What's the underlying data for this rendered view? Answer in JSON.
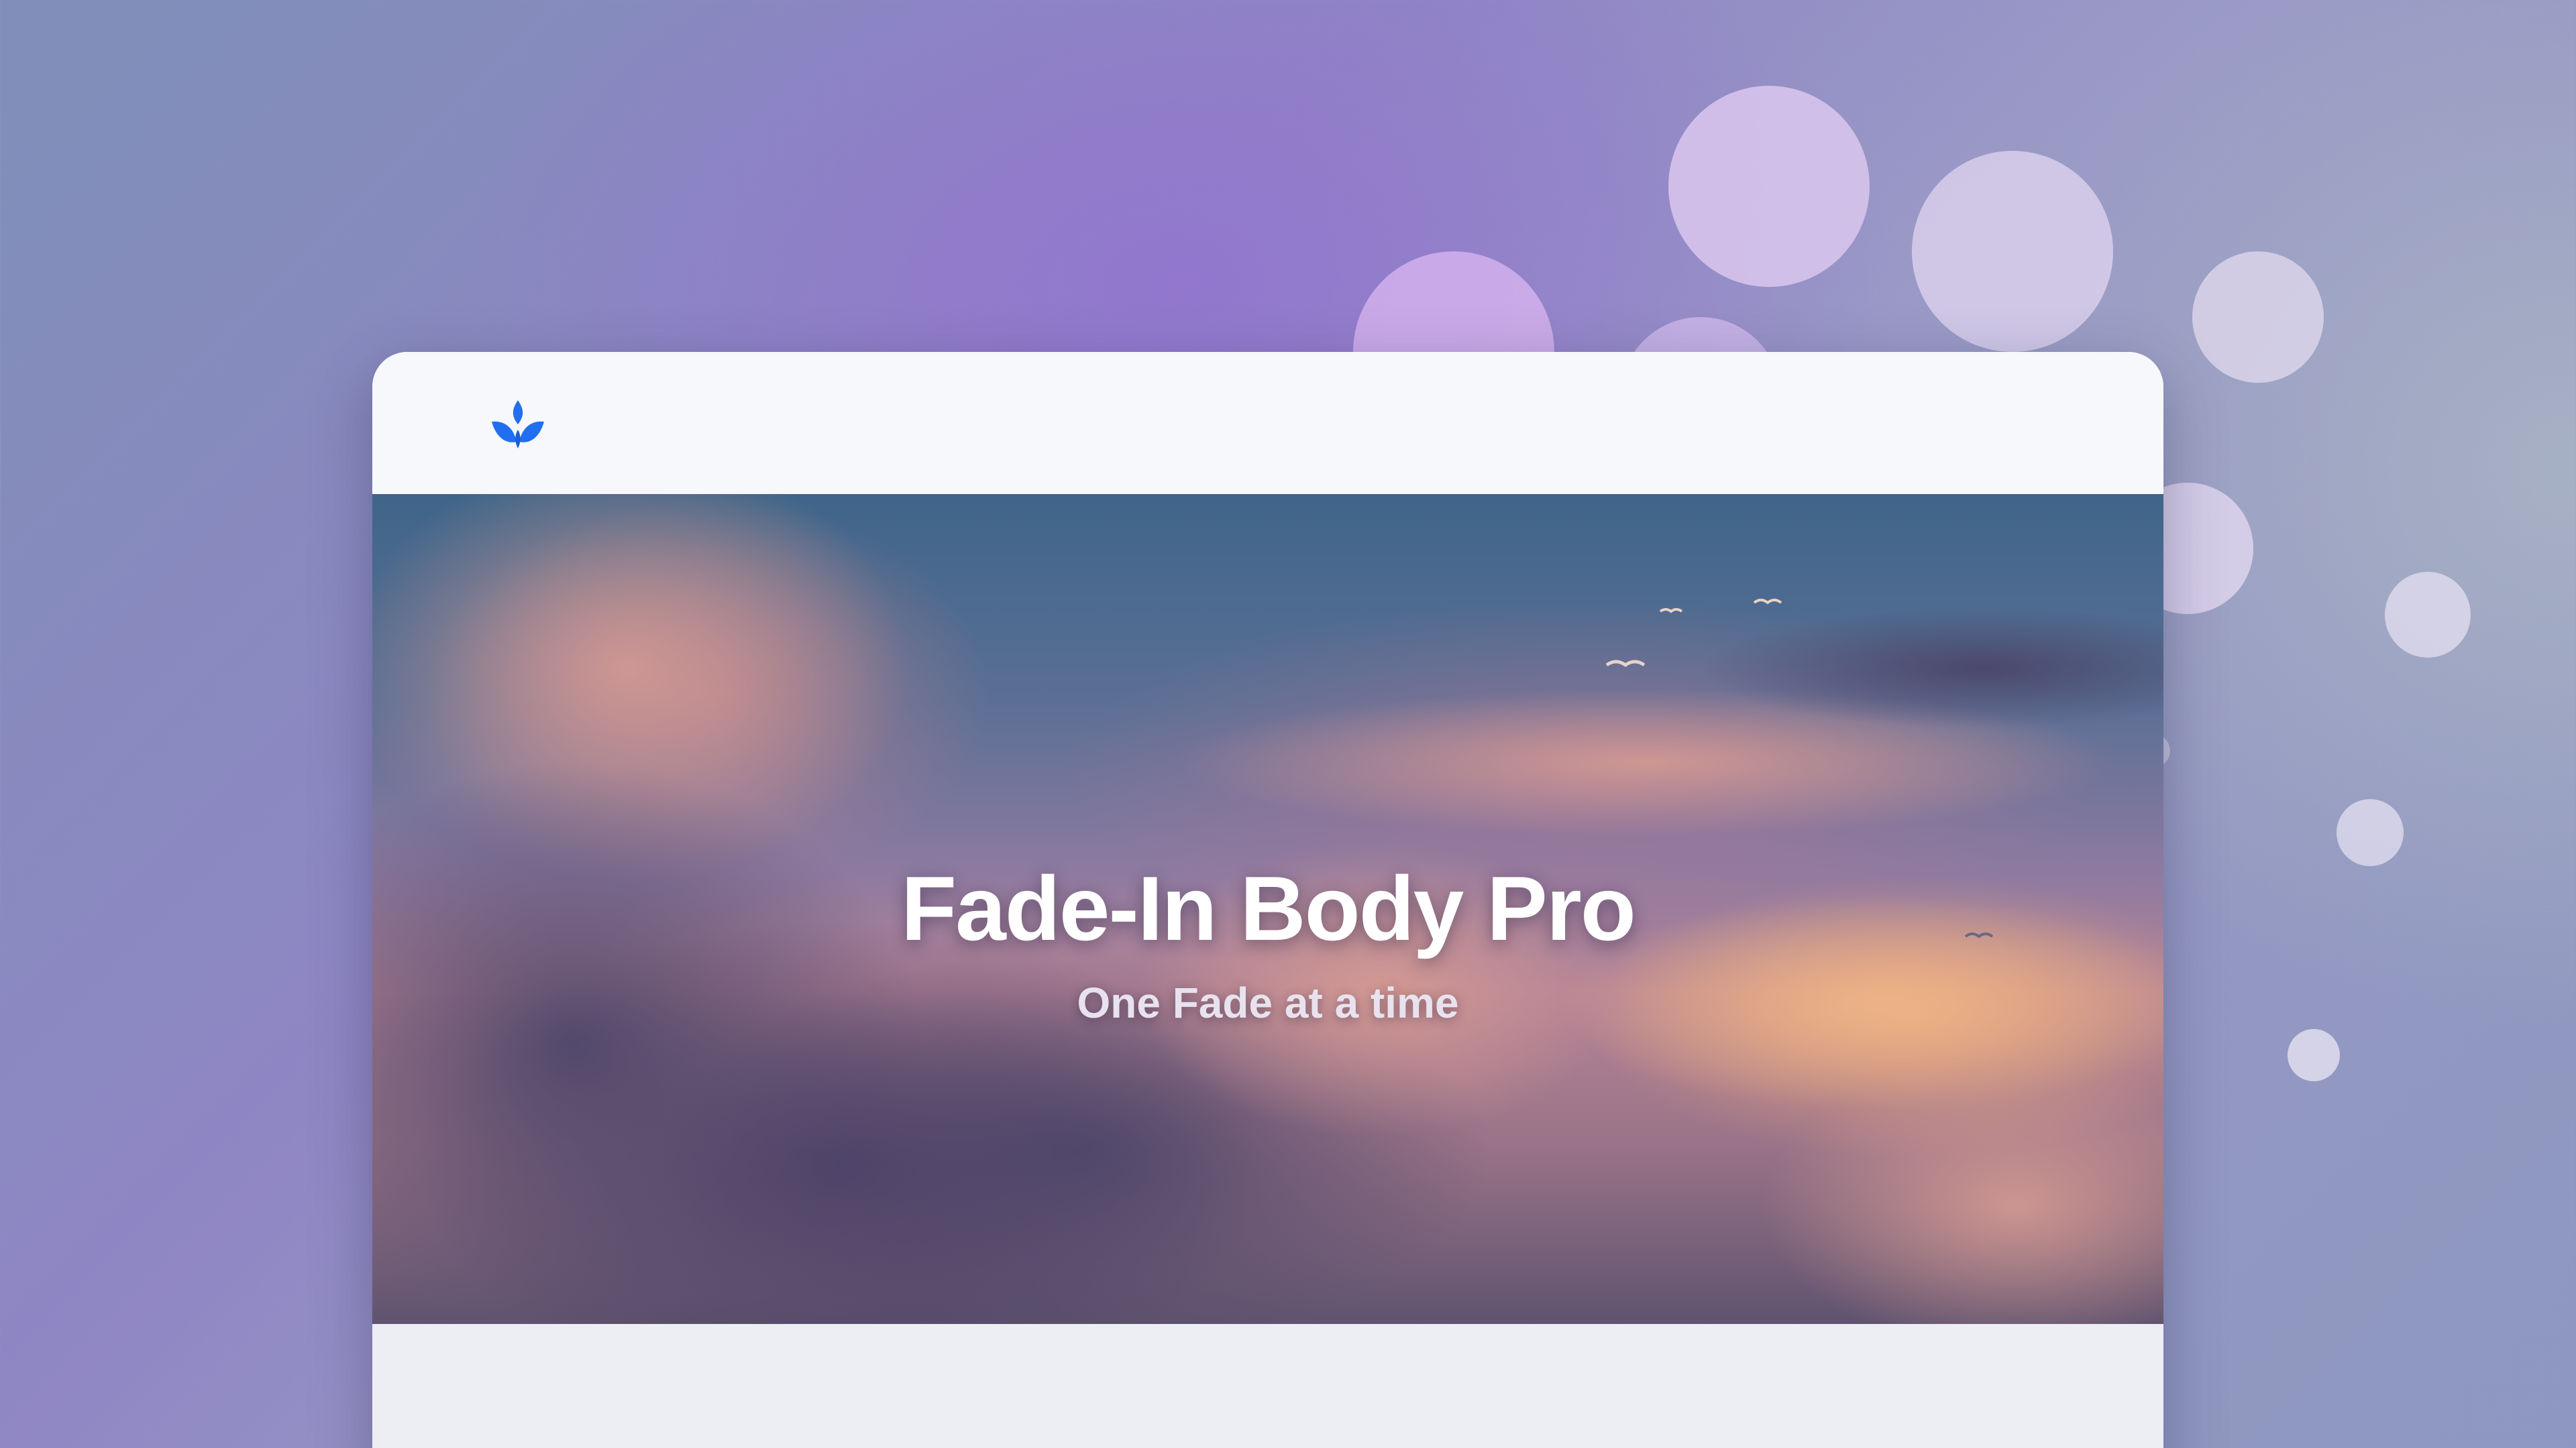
{
  "background": {
    "colors": {
      "primary": "#8f86c4",
      "secondary": "#7f8fb8",
      "bubble": "#e6d6f2"
    }
  },
  "window": {
    "logo_icon": "lotus-icon",
    "logo_color": "#1f6ff0",
    "hero": {
      "title": "Fade-In Body Pro",
      "subtitle": "One Fade at a time",
      "background_image": "sunset-clouds-sky"
    }
  }
}
